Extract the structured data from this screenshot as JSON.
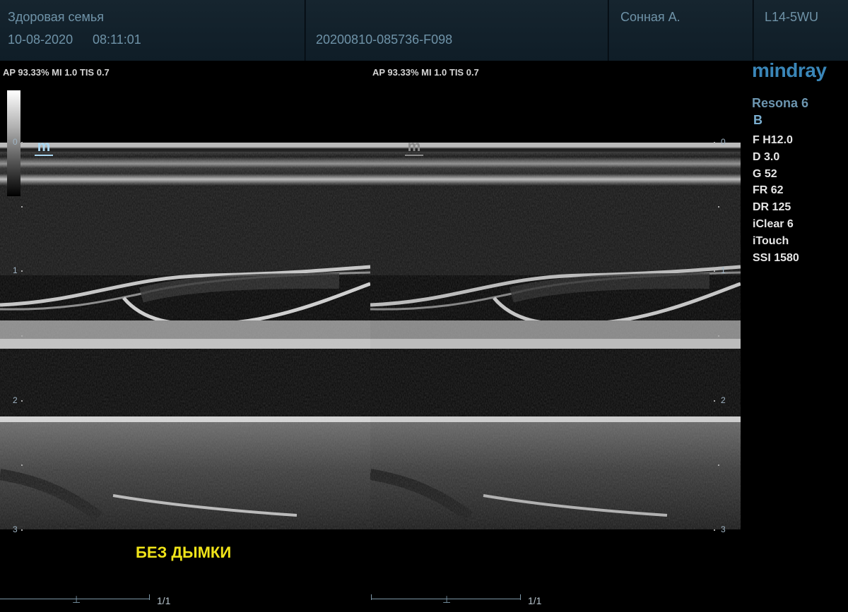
{
  "header": {
    "institution": "Здоровая семья",
    "date": "10-08-2020",
    "time": "08:11:01",
    "exam_id": "20200810-085736-F098",
    "patient": "Сонная А.",
    "probe": "L14-5WU"
  },
  "left_image": {
    "params": "AP 93.33%  MI 1.0 TIS 0.7",
    "marker": "m",
    "state": "active"
  },
  "right_image": {
    "params": "AP 93.33%  MI 1.0 TIS 0.7",
    "marker": "m",
    "state": "inactive"
  },
  "depth_scale": [
    "0",
    "1",
    "2",
    "3"
  ],
  "panel": {
    "brand": "mindray",
    "model": "Resona 6",
    "mode": "B",
    "settings": [
      "F H12.0",
      "D 3.0",
      "G 52",
      "FR 62",
      "DR 125",
      "iClear 6",
      "iTouch",
      "SSI 1580"
    ]
  },
  "annotation": "БЕЗ ДЫМКИ",
  "cine": {
    "left_counter": "1/1",
    "right_counter": "1/1",
    "thumb_glyph": "⊥"
  },
  "colors": {
    "header_bg": "#16252f",
    "label_text": "#6f93a8",
    "brand_blue": "#3a86b8",
    "annotation_yellow": "#f0e419",
    "active_marker": "#a9d6f0"
  }
}
